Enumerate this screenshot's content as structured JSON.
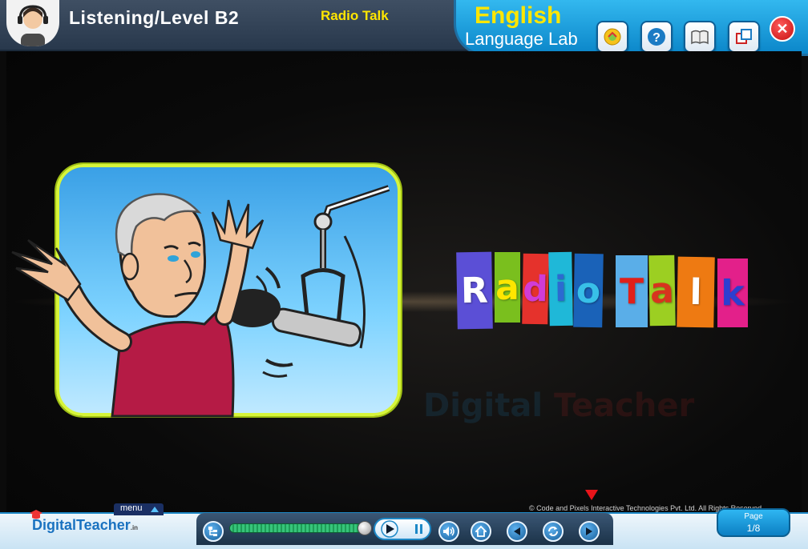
{
  "header": {
    "title": "Listening/Level B2",
    "subtitle": "Radio Talk"
  },
  "brand": {
    "line1": "English",
    "line2": "Language Lab"
  },
  "toolbar": {
    "buttons": [
      {
        "name": "score-icon"
      },
      {
        "name": "help-icon"
      },
      {
        "name": "book-icon"
      },
      {
        "name": "fullscreen-icon"
      }
    ],
    "close_icon": "close-icon",
    "close_glyph": "✕"
  },
  "content": {
    "tiles": [
      {
        "letter": "R",
        "bg": "#5b4fd6",
        "color": "#ffffff"
      },
      {
        "letter": "a",
        "bg": "#7abf1e",
        "color": "#ffe600"
      },
      {
        "letter": "d",
        "bg": "#e5322c",
        "color": "#d03cd6"
      },
      {
        "letter": "i",
        "bg": "#1fb8d8",
        "color": "#2c6ad1"
      },
      {
        "letter": "o",
        "bg": "#1a62b8",
        "color": "#38c0e8"
      },
      {
        "letter": "T",
        "bg": "#5aaee8",
        "color": "#e0201a"
      },
      {
        "letter": "a",
        "bg": "#9ccf22",
        "color": "#d7351e"
      },
      {
        "letter": "l",
        "bg": "#ee7a12",
        "color": "#ffffff"
      },
      {
        "letter": "k",
        "bg": "#e3208a",
        "color": "#2c3fd1"
      }
    ],
    "watermark_part1": "Digital",
    "watermark_part2": "Teacher"
  },
  "footer": {
    "copyright": "© Code and Pixels Interactive Technologies  Pvt. Ltd. All Rights Reserved",
    "logo_part1": "Digital",
    "logo_part2": "Teacher",
    "logo_suffix": ".in",
    "menu_label": "menu",
    "page_label": "Page",
    "page_value": "1/8",
    "progress": 0.98
  }
}
